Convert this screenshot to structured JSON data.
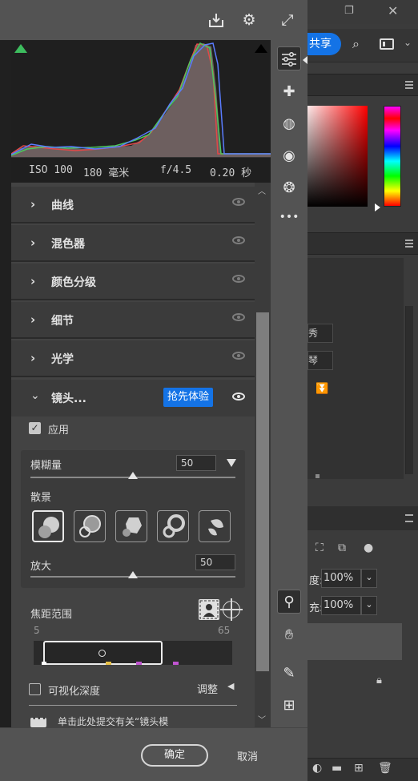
{
  "toolbar": {
    "icons": [
      "download-icon",
      "gear-icon",
      "fullscreen-icon"
    ]
  },
  "histogram": {
    "clip_left_color": "#3dbd5e",
    "clip_right_color": "#000000"
  },
  "exif": {
    "iso": "ISO 100",
    "focal": "180 毫米",
    "aperture": "f/4.5",
    "shutter": "0.20 秒"
  },
  "sections": [
    {
      "label": "曲线"
    },
    {
      "label": "混色器"
    },
    {
      "label": "颜色分级"
    },
    {
      "label": "细节"
    },
    {
      "label": "光学"
    }
  ],
  "lens": {
    "title": "镜头...",
    "badge": "抢先体验",
    "apply_label": "应用",
    "blur_label": "模糊量",
    "blur_value": "50",
    "bokeh_label": "散景",
    "boost_label": "放大",
    "boost_value": "50",
    "focus_range_label": "焦距范围",
    "focus_min": "5",
    "focus_max": "65",
    "visualize_label": "可视化深度",
    "adjust_label": "调整",
    "feedback_text": "单击此处提交有关“镜头模"
  },
  "dialog": {
    "ok_label": "确定",
    "cancel_label": "取消"
  },
  "ps": {
    "share_label": "共享",
    "field1": "秀",
    "field2": "琴",
    "opacity_label": "度:",
    "opacity_value": "100%",
    "fill_label": "充:",
    "fill_value": "100%",
    "accent": "#1473e6"
  }
}
